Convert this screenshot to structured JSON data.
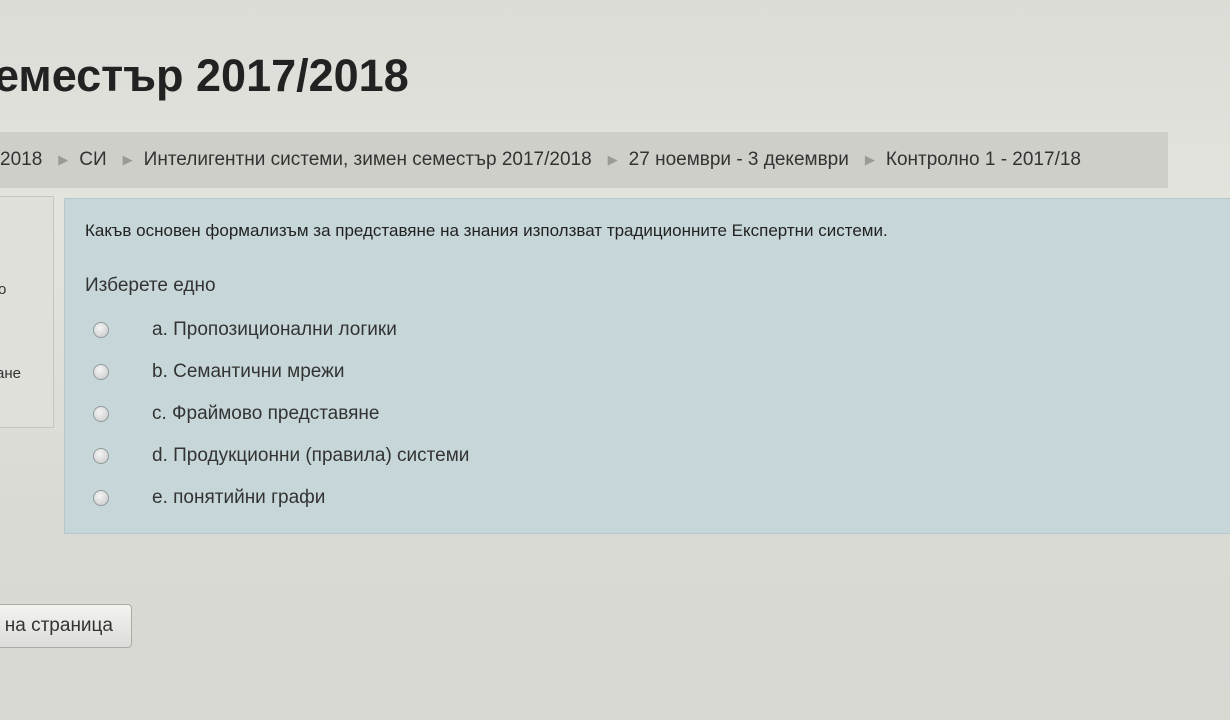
{
  "page_title": "еместър 2017/2018",
  "breadcrumb": [
    "2018",
    "СИ",
    "Интелигентни системи, зимен семестър 2017/2018",
    "27 ноември - 3 декември",
    "Контролно 1 - 2017/18"
  ],
  "sidebar_fragments": [
    "о",
    "ане"
  ],
  "question": {
    "text": "Какъв основен формализъм за представяне на знания използват традиционните Експертни системи.",
    "prompt": "Изберете едно",
    "answers": [
      "a. Пропозиционални логики",
      "b. Семантични мрежи",
      "c. Фраймово представяне",
      "d. Продукционни (правила) системи",
      "e. понятийни графи"
    ]
  },
  "nav_button_label": "на страница"
}
